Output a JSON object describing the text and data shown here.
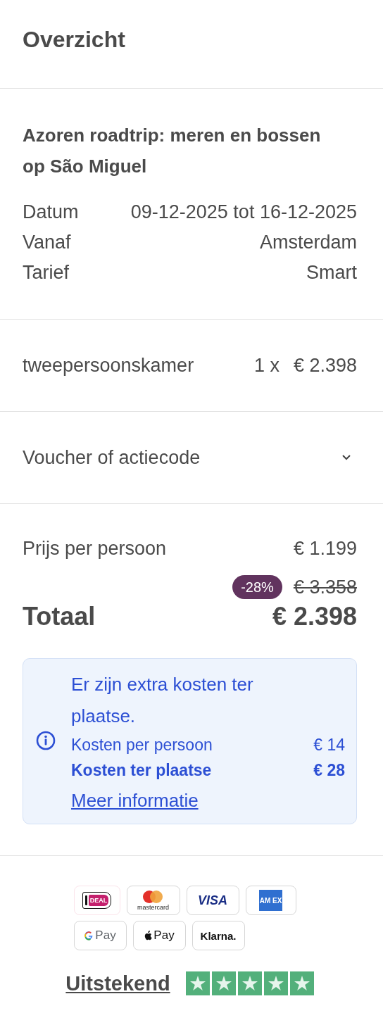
{
  "title": "Overzicht",
  "trip": {
    "name": "Azoren roadtrip: meren en bossen op São Miguel",
    "details": [
      {
        "label": "Datum",
        "value": "09-12-2025 tot 16-12-2025"
      },
      {
        "label": "Vanaf",
        "value": "Amsterdam"
      },
      {
        "label": "Tarief",
        "value": "Smart"
      }
    ]
  },
  "rooms": [
    {
      "name": "tweepersoonskamer",
      "quantity": "1 x",
      "price": "€ 2.398"
    }
  ],
  "voucher": {
    "label": "Voucher of actiecode",
    "expanded": false
  },
  "pricing": {
    "per_person_label": "Prijs per persoon",
    "per_person": "€ 1.199",
    "discount": "-28%",
    "old_price": "€ 3.358",
    "total_label": "Totaal",
    "total": "€ 2.398"
  },
  "notice": {
    "message": "Er zijn extra kosten ter plaatse.",
    "rows": [
      {
        "label": "Kosten per persoon",
        "value": "€ 14",
        "bold": false
      },
      {
        "label": "Kosten ter plaatse",
        "value": "€ 28",
        "bold": true
      }
    ],
    "link": "Meer informatie"
  },
  "payment_methods": [
    {
      "kind": "ideal",
      "label": "DEAL"
    },
    {
      "kind": "mastercard",
      "label": "mastercard"
    },
    {
      "kind": "visa",
      "label": "VISA"
    },
    {
      "kind": "amex",
      "label": "AM EX"
    },
    {
      "kind": "gpay",
      "label": "Pay"
    },
    {
      "kind": "applepay",
      "label": "Pay"
    },
    {
      "kind": "klarna",
      "label": "Klarna."
    }
  ],
  "rating": {
    "label": "Uitstekend",
    "stars": 5
  }
}
